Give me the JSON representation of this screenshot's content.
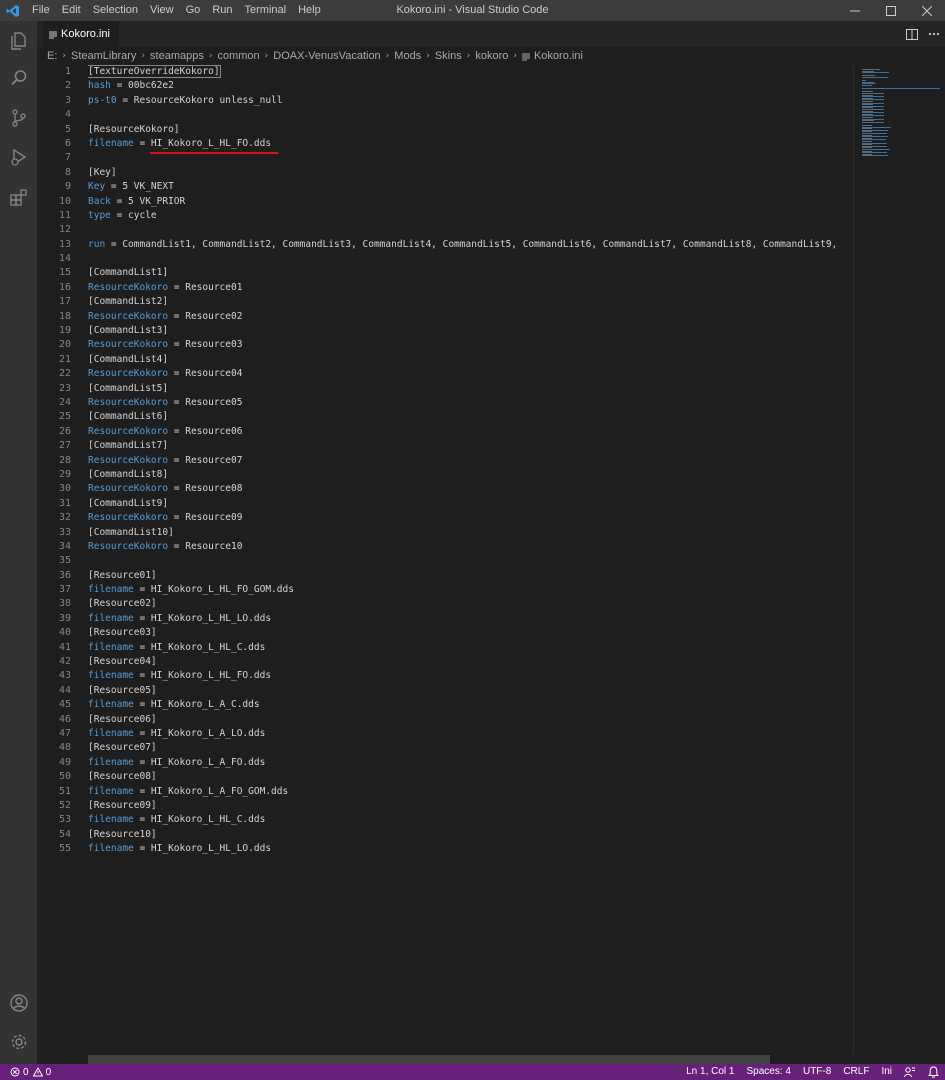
{
  "window": {
    "title": "Kokoro.ini - Visual Studio Code",
    "menu": [
      "File",
      "Edit",
      "Selection",
      "View",
      "Go",
      "Run",
      "Terminal",
      "Help"
    ]
  },
  "tab": {
    "label": "Kokoro.ini"
  },
  "breadcrumb": [
    "E:",
    "SteamLibrary",
    "steamapps",
    "common",
    "DOAX-VenusVacation",
    "Mods",
    "Skins",
    "kokoro",
    "Kokoro.ini"
  ],
  "editor": {
    "lines": [
      {
        "h": "[TextureOverrideKokoro]"
      },
      {
        "k": "hash",
        "v": " = 00bc62e2"
      },
      {
        "k": "ps-t0",
        "v": " = ResourceKokoro unless_null"
      },
      {
        "v": ""
      },
      {
        "h": "[ResourceKokoro]"
      },
      {
        "k": "filename",
        "v": " = HI_Kokoro_L_HL_FO.dds"
      },
      {
        "v": ""
      },
      {
        "h": "[Key]"
      },
      {
        "k": "Key",
        "v": " = 5 VK_NEXT"
      },
      {
        "k": "Back",
        "v": " = 5 VK_PRIOR"
      },
      {
        "k": "type",
        "v": " = cycle"
      },
      {
        "v": ""
      },
      {
        "k": "run",
        "v": " = CommandList1, CommandList2, CommandList3, CommandList4, CommandList5, CommandList6, CommandList7, CommandList8, CommandList9,"
      },
      {
        "v": ""
      },
      {
        "h": "[CommandList1]"
      },
      {
        "k": "ResourceKokoro",
        "v": " = Resource01"
      },
      {
        "h": "[CommandList2]"
      },
      {
        "k": "ResourceKokoro",
        "v": " = Resource02"
      },
      {
        "h": "[CommandList3]"
      },
      {
        "k": "ResourceKokoro",
        "v": " = Resource03"
      },
      {
        "h": "[CommandList4]"
      },
      {
        "k": "ResourceKokoro",
        "v": " = Resource04"
      },
      {
        "h": "[CommandList5]"
      },
      {
        "k": "ResourceKokoro",
        "v": " = Resource05"
      },
      {
        "h": "[CommandList6]"
      },
      {
        "k": "ResourceKokoro",
        "v": " = Resource06"
      },
      {
        "h": "[CommandList7]"
      },
      {
        "k": "ResourceKokoro",
        "v": " = Resource07"
      },
      {
        "h": "[CommandList8]"
      },
      {
        "k": "ResourceKokoro",
        "v": " = Resource08"
      },
      {
        "h": "[CommandList9]"
      },
      {
        "k": "ResourceKokoro",
        "v": " = Resource09"
      },
      {
        "h": "[CommandList10]"
      },
      {
        "k": "ResourceKokoro",
        "v": " = Resource10"
      },
      {
        "v": ""
      },
      {
        "h": "[Resource01]"
      },
      {
        "k": "filename",
        "v": " = HI_Kokoro_L_HL_FO_GOM.dds"
      },
      {
        "h": "[Resource02]"
      },
      {
        "k": "filename",
        "v": " = HI_Kokoro_L_HL_LO.dds"
      },
      {
        "h": "[Resource03]"
      },
      {
        "k": "filename",
        "v": " = HI_Kokoro_L_HL_C.dds"
      },
      {
        "h": "[Resource04]"
      },
      {
        "k": "filename",
        "v": " = HI_Kokoro_L_HL_FO.dds"
      },
      {
        "h": "[Resource05]"
      },
      {
        "k": "filename",
        "v": " = HI_Kokoro_L_A_C.dds"
      },
      {
        "h": "[Resource06]"
      },
      {
        "k": "filename",
        "v": " = HI_Kokoro_L_A_LO.dds"
      },
      {
        "h": "[Resource07]"
      },
      {
        "k": "filename",
        "v": " = HI_Kokoro_L_A_FO.dds"
      },
      {
        "h": "[Resource08]"
      },
      {
        "k": "filename",
        "v": " = HI_Kokoro_L_A_FO_GOM.dds"
      },
      {
        "h": "[Resource09]"
      },
      {
        "k": "filename",
        "v": " = HI_Kokoro_L_HL_C.dds"
      },
      {
        "h": "[Resource10]"
      },
      {
        "k": "filename",
        "v": " = HI_Kokoro_L_HL_LO.dds"
      }
    ]
  },
  "statusbar": {
    "errors": "0",
    "warnings": "0",
    "position": "Ln 1, Col 1",
    "spaces": "Spaces: 4",
    "encoding": "UTF-8",
    "eol": "CRLF",
    "language": "Ini"
  },
  "colors": {
    "statusbar": "#68217a",
    "keyword": "#569cd6",
    "annotation": "#d7141b"
  },
  "icons": [
    "vscode-logo-icon",
    "explorer-icon",
    "search-icon",
    "source-control-icon",
    "run-debug-icon",
    "extensions-icon",
    "account-icon",
    "settings-gear-icon",
    "split-editor-icon",
    "more-actions-icon",
    "file-icon",
    "error-icon",
    "warning-icon",
    "feedback-icon",
    "bell-icon"
  ]
}
